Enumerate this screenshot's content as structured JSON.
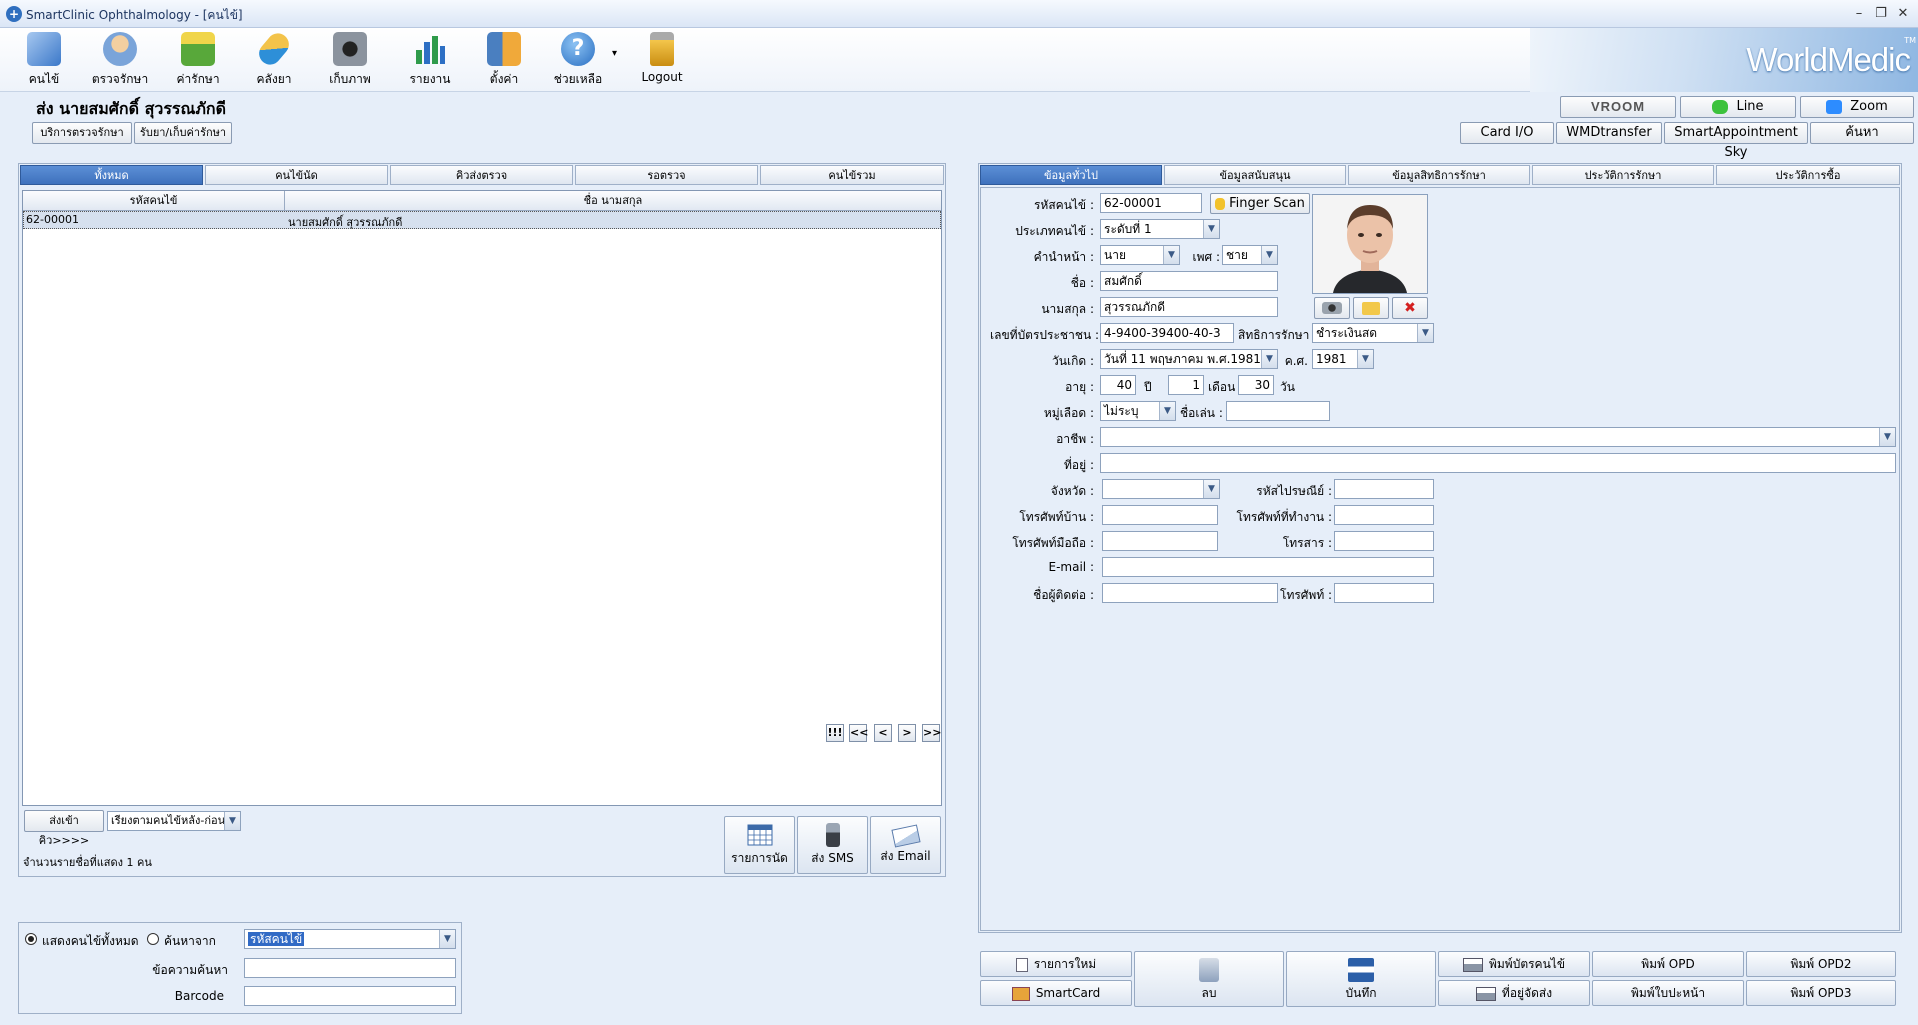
{
  "window": {
    "title": "SmartClinic Ophthalmology - [คนไข้]",
    "minimize": "–",
    "restore": "❐",
    "close": "✕"
  },
  "toolbar": {
    "items": [
      {
        "label": "คนไข้",
        "icon": "patient-book-icon",
        "color": "#3b78c9"
      },
      {
        "label": "ตรวจรักษา",
        "icon": "doctor-icon",
        "color": "#e4a85b"
      },
      {
        "label": "ค่ารักษา",
        "icon": "money-icon",
        "color": "#58a83a"
      },
      {
        "label": "คลังยา",
        "icon": "pill-icon",
        "color": "#2d8fd8"
      },
      {
        "label": "เก็บภาพ",
        "icon": "camera-icon",
        "color": "#555c66"
      },
      {
        "label": "รายงาน",
        "icon": "bar-chart-icon",
        "color": "#2f9b4b"
      },
      {
        "label": "ตั้งค่า",
        "icon": "settings-tools-icon",
        "color": "#4a7fc0"
      },
      {
        "label": "ช่วยเหลือ",
        "icon": "help-icon",
        "color": "#3d85d6"
      },
      {
        "label": "Logout",
        "icon": "lock-icon",
        "color": "#d9a322"
      }
    ],
    "help_dropdown": "▾"
  },
  "brand": {
    "name": "WorldMedic",
    "tm": "TM"
  },
  "header": {
    "patient_title": "ส่ง  นายสมศักดิ์ สุวรรณภักดี",
    "btn_service": "บริการตรวจรักษา",
    "btn_drug": "รับยา/เก็บค่ารักษา"
  },
  "comm": {
    "vroom": "VROOM",
    "line": "Line",
    "zoom": "Zoom"
  },
  "actions": {
    "card_io": "Card I/O",
    "wmd": "WMDtransfer",
    "sky": "SmartAppointment Sky",
    "search": "ค้นหา"
  },
  "left": {
    "tabs": [
      "ทั้งหมด",
      "คนไข้นัด",
      "คิวส่งตรวจ",
      "รอตรวจ",
      "คนไข้รวม"
    ],
    "columns": [
      "รหัสคนไข้",
      "ชื่อ นามสกุล"
    ],
    "rows": [
      {
        "id": "62-00001",
        "name": "นายสมศักดิ์ สุวรรณภักดี"
      }
    ],
    "queue_btn": "ส่งเข้าคิว>>>>",
    "sort": "เรียงตามคนไข้หลัง-ก่อน",
    "count": "จำนวนรายชื่อที่แสดง 1 คน",
    "btn_appt": "รายการนัด",
    "btn_sms": "ส่ง SMS",
    "btn_email": "ส่ง Email",
    "nav": [
      "!!!",
      "<<",
      "<",
      ">",
      ">>"
    ]
  },
  "search": {
    "opt_all": "แสดงคนไข้ทั้งหมด",
    "opt_from": "ค้นหาจาก",
    "search_by": "รหัสคนไข้",
    "text_label": "ข้อความค้นหา",
    "barcode_label": "Barcode",
    "text_value": "",
    "barcode_value": ""
  },
  "right": {
    "tabs": [
      "ข้อมูลทั่วไป",
      "ข้อมูลสนับสนุน",
      "ข้อมูลสิทธิการรักษา",
      "ประวัติการรักษา",
      "ประวัติการซื้อ"
    ],
    "form": {
      "l_id": "รหัสคนไข้ :",
      "id": "62-00001",
      "finger": "Finger Scan",
      "l_type": "ประเภทคนไข้ :",
      "type": "ระดับที่ 1",
      "l_prefix": "คำนำหน้า :",
      "prefix": "นาย",
      "l_sex": "เพศ :",
      "sex": "ชาย",
      "l_first": "ชื่อ :",
      "first": "สมศักดิ์",
      "l_last": "นามสกุล :",
      "last": "สุวรรณภักดี",
      "l_cid": "เลขที่บัตรประชาชน :",
      "cid": "4-9400-39400-40-3",
      "l_right": "สิทธิการรักษา :",
      "right": "ชำระเงินสด",
      "l_dob": "วันเกิด :",
      "dob": "วันที่ 11  พฤษภาคม  พ.ศ.1981",
      "l_ad": "ค.ศ.",
      "ad": "1981",
      "l_age": "อายุ :",
      "age_y": "40",
      "l_y": "ปี",
      "age_m": "1",
      "l_m": "เดือน",
      "age_d": "30",
      "l_d": "วัน",
      "l_blood": "หมู่เลือด :",
      "blood": "ไม่ระบุ",
      "l_nick": "ชื่อเล่น :",
      "nick": "",
      "l_job": "อาชีพ :",
      "job": "",
      "l_addr": "ที่อยู่ :",
      "addr": "",
      "l_prov": "จังหวัด :",
      "prov": "",
      "l_zip": "รหัสไปรษณีย์ :",
      "zip": "",
      "l_home": "โทรศัพท์บ้าน :",
      "home": "",
      "l_work": "โทรศัพท์ที่ทำงาน :",
      "work": "",
      "l_mobile": "โทรศัพท์มือถือ :",
      "mobile": "",
      "l_fax": "โทรสาร :",
      "fax": "",
      "l_email": "E-mail :",
      "email": "",
      "l_contact": "ชื่อผู้ติดต่อ :",
      "contact": "",
      "l_ctel": "โทรศัพท์ :",
      "ctel": ""
    },
    "bottom": {
      "new": "รายการใหม่",
      "smartcard": "SmartCard",
      "delete": "ลบ",
      "save": "บันทึก",
      "print_card": "พิมพ์บัตรคนไข้",
      "addr_send": "ที่อยู่จัดส่ง",
      "opd": "พิมพ์ OPD",
      "referral": "พิมพ์ใบปะหน้า",
      "opd2": "พิมพ์ OPD2",
      "opd3": "พิมพ์ OPD3"
    }
  }
}
